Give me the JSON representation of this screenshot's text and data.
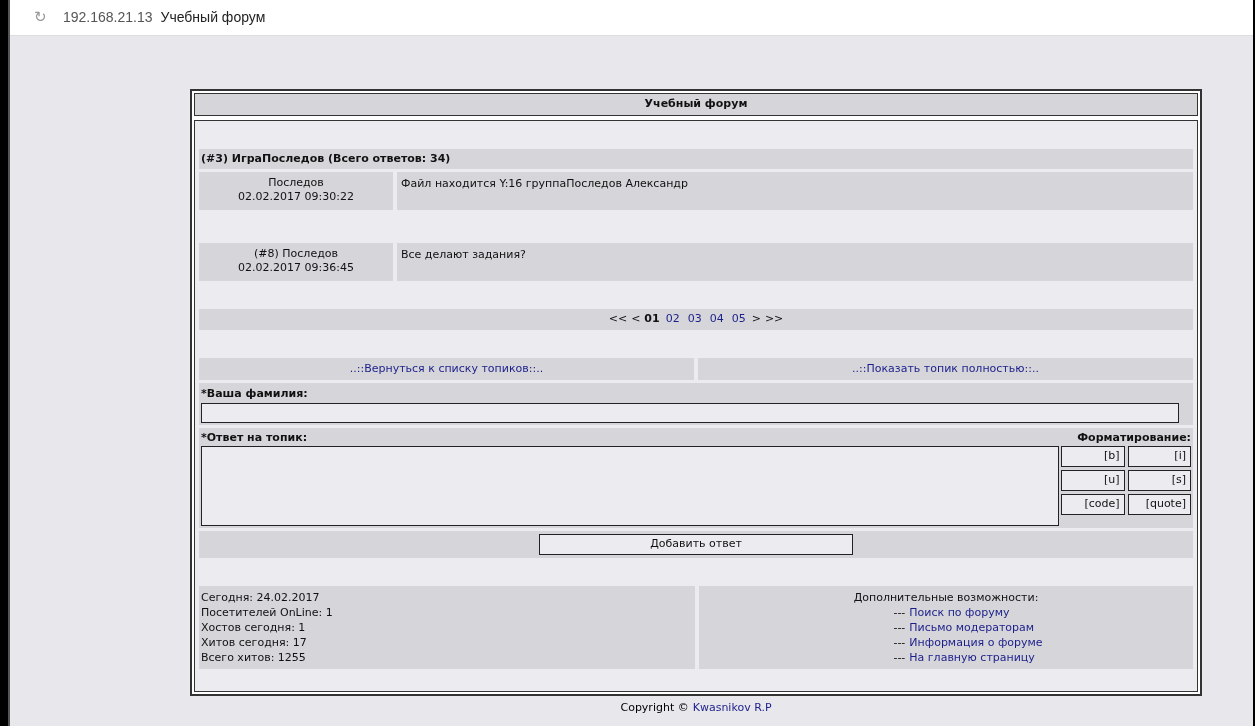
{
  "browser": {
    "icon": "↻",
    "address": "192.168.21.13",
    "title": "Учебный форум"
  },
  "forum": {
    "title": "Учебный форум"
  },
  "topic": {
    "heading": "(#3) ИграПоследов (Всего ответов: 34)",
    "posts": [
      {
        "author": "Последов",
        "date": "02.02.2017 09:30:22",
        "text": "Файл находится Y:16 группаПоследов Александр"
      },
      {
        "author": "(#8) Последов",
        "date": "02.02.2017 09:36:45",
        "text": "Все делают задания?"
      }
    ]
  },
  "pagination": {
    "first": "<<",
    "prev": "<",
    "pages": [
      {
        "label": "01",
        "selected": true
      },
      {
        "label": "02",
        "selected": false
      },
      {
        "label": "03",
        "selected": false
      },
      {
        "label": "04",
        "selected": false
      },
      {
        "label": "05",
        "selected": false
      }
    ],
    "next": ">",
    "last": ">>"
  },
  "nav_links": [
    "..::Вернуться к списку топиков::..",
    "..::Показать топик полностью::.."
  ],
  "form": {
    "name_label": "*Ваша фамилия:",
    "reply_label": "*Ответ на топик:",
    "formatting_label": "Форматирование:",
    "format_buttons": [
      "[b]",
      "[i]",
      "[u]",
      "[s]",
      "[code]",
      "[quote]"
    ],
    "submit": "Добавить ответ"
  },
  "stats": [
    "Сегодня: 24.02.2017",
    "Посетителей OnLine: 1",
    "Хостов сегодня: 1",
    "Хитов сегодня: 17",
    "Всего хитов: 1255"
  ],
  "extras": {
    "title": "Дополнительные возможности:",
    "prefix": "---",
    "links": [
      "Поиск по форуму",
      "Письмо модераторам",
      "Информация о форуме",
      "На главную страницу"
    ]
  },
  "copyright": {
    "text": "Copyright ©",
    "link": "Kwasnikov R.P"
  }
}
